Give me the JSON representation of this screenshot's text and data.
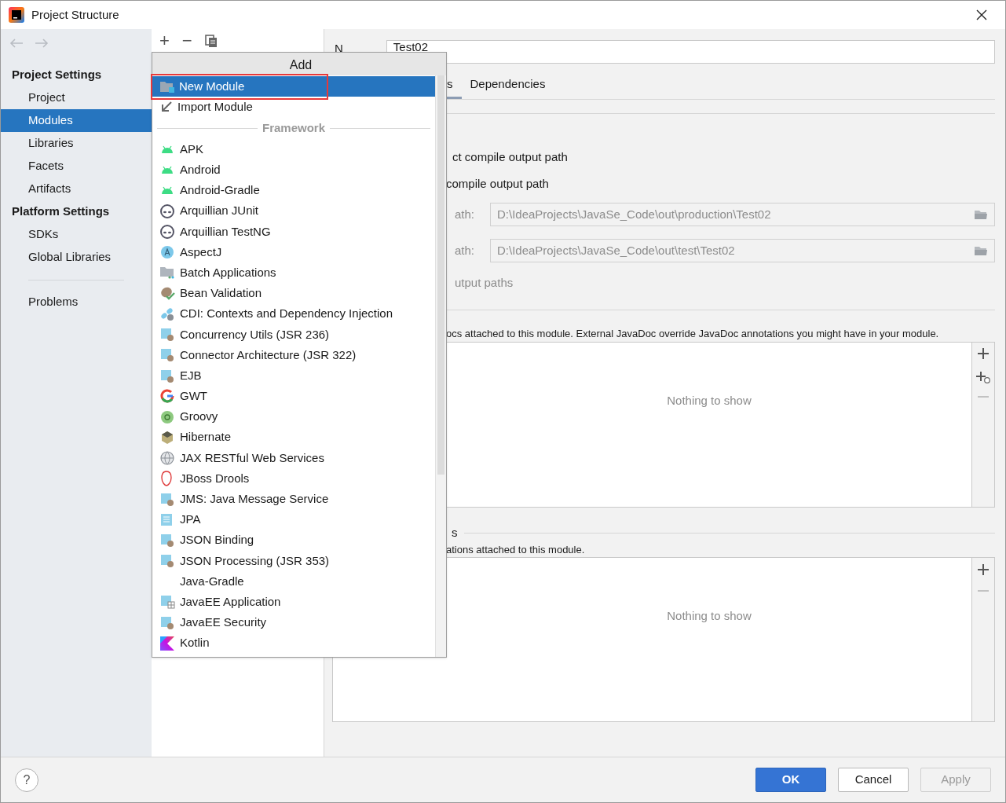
{
  "window": {
    "title": "Project Structure"
  },
  "sidebar": {
    "groups": [
      {
        "heading": "Project Settings",
        "items": [
          {
            "label": "Project",
            "selected": false
          },
          {
            "label": "Modules",
            "selected": true
          },
          {
            "label": "Libraries",
            "selected": false
          },
          {
            "label": "Facets",
            "selected": false
          },
          {
            "label": "Artifacts",
            "selected": false
          }
        ]
      },
      {
        "heading": "Platform Settings",
        "items": [
          {
            "label": "SDKs",
            "selected": false
          },
          {
            "label": "Global Libraries",
            "selected": false
          }
        ]
      }
    ],
    "extra_items": [
      {
        "label": "Problems",
        "selected": false
      }
    ]
  },
  "toolbar": {
    "add": "+",
    "remove": "−"
  },
  "popup": {
    "title": "Add",
    "actions": [
      {
        "label": "New Module",
        "selected": true,
        "highlighted": true
      },
      {
        "label": "Import Module",
        "selected": false,
        "highlighted": false
      }
    ],
    "section": "Framework",
    "frameworks": [
      {
        "label": "APK"
      },
      {
        "label": "Android"
      },
      {
        "label": "Android-Gradle"
      },
      {
        "label": "Arquillian JUnit"
      },
      {
        "label": "Arquillian TestNG"
      },
      {
        "label": "AspectJ"
      },
      {
        "label": "Batch Applications"
      },
      {
        "label": "Bean Validation"
      },
      {
        "label": "CDI: Contexts and Dependency Injection"
      },
      {
        "label": "Concurrency Utils (JSR 236)"
      },
      {
        "label": "Connector Architecture (JSR 322)"
      },
      {
        "label": "EJB"
      },
      {
        "label": "GWT"
      },
      {
        "label": "Groovy"
      },
      {
        "label": "Hibernate"
      },
      {
        "label": "JAX RESTful Web Services"
      },
      {
        "label": "JBoss Drools"
      },
      {
        "label": "JMS: Java Message Service"
      },
      {
        "label": "JPA"
      },
      {
        "label": "JSON Binding"
      },
      {
        "label": "JSON Processing (JSR 353)"
      },
      {
        "label": "Java-Gradle"
      },
      {
        "label": "JavaEE Application"
      },
      {
        "label": "JavaEE Security"
      },
      {
        "label": "Kotlin"
      }
    ]
  },
  "module": {
    "name_label": "N",
    "name_value": "Test02",
    "tabs": [
      {
        "label": "s",
        "selected": true
      },
      {
        "label": "Dependencies",
        "selected": false
      }
    ],
    "option_1": "ct compile output path",
    "option_2": "compile output path",
    "paths": [
      {
        "label": "ath:",
        "value": "D:\\IdeaProjects\\JavaSe_Code\\out\\production\\Test02"
      },
      {
        "label": "ath:",
        "value": "D:\\IdeaProjects\\JavaSe_Code\\out\\test\\Test02"
      }
    ],
    "option_3": "utput paths",
    "javadoc": {
      "description": "ocs attached to this module. External JavaDoc override JavaDoc annotations you might have in your module.",
      "empty": "Nothing to show"
    },
    "annotations": {
      "heading": "s",
      "description": "ations attached to this module.",
      "empty": "Nothing to show"
    }
  },
  "buttons": {
    "help": "?",
    "ok": "OK",
    "cancel": "Cancel",
    "apply": "Apply",
    "apply_disabled": true
  }
}
